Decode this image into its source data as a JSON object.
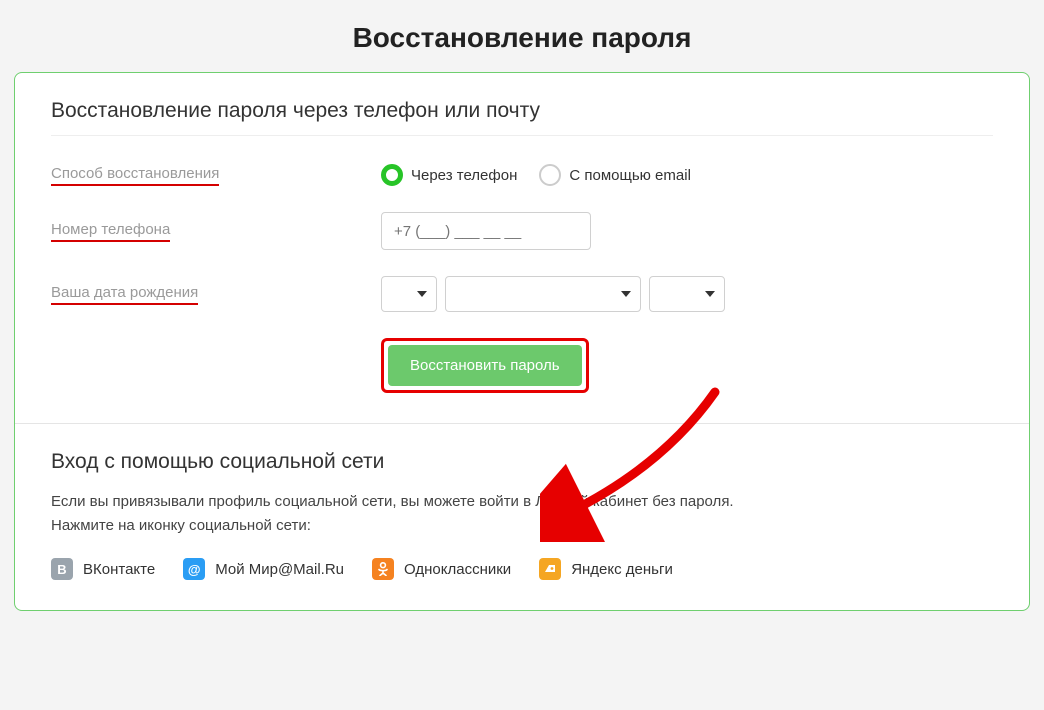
{
  "page_title": "Восстановление пароля",
  "form": {
    "heading": "Восстановление пароля через телефон или почту",
    "labels": {
      "method": "Способ восстановления",
      "phone": "Номер телефона",
      "dob": "Ваша дата рождения"
    },
    "radios": {
      "phone": "Через телефон",
      "email": "С помощью email"
    },
    "phone_placeholder": "+7 (___) ___ __ __",
    "submit": "Восстановить пароль"
  },
  "social": {
    "heading": "Вход с помощью социальной сети",
    "text_line1": "Если вы привязывали профиль социальной сети, вы можете войти в Личный кабинет без пароля.",
    "text_line2": "Нажмите на иконку социальной сети:",
    "items": {
      "vk": "ВКонтакте",
      "mm": "Мой Мир@Mail.Ru",
      "ok": "Одноклассники",
      "ym": "Яндекс деньги"
    }
  }
}
